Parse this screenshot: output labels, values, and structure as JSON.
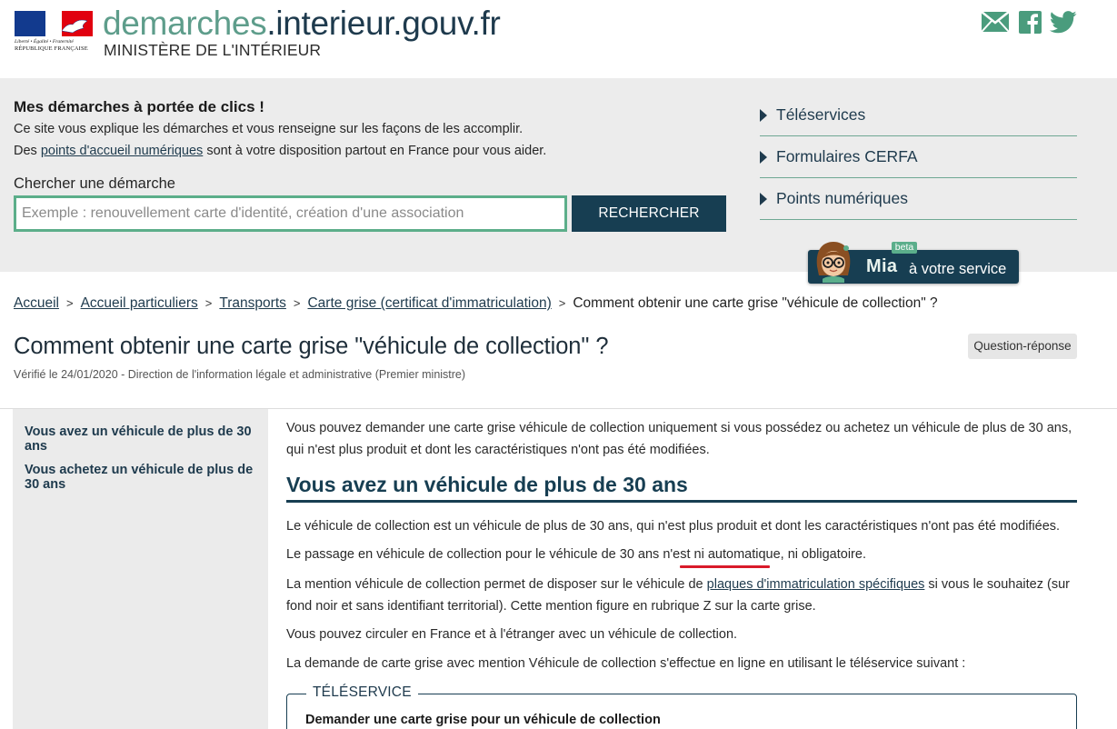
{
  "header": {
    "logo": {
      "motto": "Liberté • Égalité • Fraternité",
      "republic": "RÉPUBLIQUE FRANÇAISE"
    },
    "site_title_main": "demarches",
    "site_title_tail": ".interieur.gouv.fr",
    "site_subtitle": "MINISTÈRE DE L'INTÉRIEUR",
    "social_icons": [
      "mail-icon",
      "facebook-icon",
      "twitter-icon"
    ],
    "brand_color": "#5e9d8b"
  },
  "intro": {
    "title": "Mes démarches à portée de clics !",
    "line1": "Ce site vous explique les démarches et vous renseigne sur les façons de les accomplir.",
    "line2_pre": "Des ",
    "line2_link": "points d'accueil numériques",
    "line2_post": " sont à votre disposition partout en France pour vous aider."
  },
  "search": {
    "label": "Chercher une démarche",
    "placeholder": "Exemple : renouvellement carte d'identité, création d'une association",
    "button": "RECHERCHER"
  },
  "quick_links": [
    "Téléservices",
    "Formulaires CERFA",
    "Points numériques"
  ],
  "mia": {
    "name": "Mia",
    "tagline": "à votre service",
    "badge": "beta"
  },
  "breadcrumb": {
    "items": [
      "Accueil",
      "Accueil particuliers",
      "Transports",
      "Carte grise (certificat d'immatriculation)"
    ],
    "current": "Comment obtenir une carte grise \"véhicule de collection\" ?",
    "separator": ">"
  },
  "page": {
    "title": "Comment obtenir une carte grise \"véhicule de collection\" ?",
    "verified": "Vérifié le 24/01/2020 - Direction de l'information légale et administrative (Premier ministre)",
    "badge": "Question-réponse"
  },
  "toc": [
    "Vous avez un véhicule de plus de 30 ans",
    "Vous achetez un véhicule de plus de 30 ans"
  ],
  "content": {
    "intro": "Vous pouvez demander une carte grise véhicule de collection uniquement si vous possédez ou achetez un véhicule de plus de 30 ans, qui n'est plus produit et dont les caractéristiques n'ont pas été modifiées.",
    "h2": "Vous avez un véhicule de plus de 30 ans",
    "p1": "Le véhicule de collection est un véhicule de plus de 30 ans, qui n'est plus produit et dont les caractéristiques n'ont pas été modifiées.",
    "p2": "Le passage en véhicule de collection pour le véhicule de 30 ans n'est ni automatique, ni obligatoire.",
    "p3_pre": "La mention véhicule de collection permet de disposer sur le véhicule de ",
    "p3_link": "plaques d'immatriculation spécifiques",
    "p3_post": " si vous le souhaitez (sur fond noir et sans identifiant territorial). Cette mention figure en rubrique Z sur la carte grise.",
    "p4": "Vous pouvez circuler en France et à l'étranger avec un véhicule de collection.",
    "p5": "La demande de carte grise avec mention Véhicule de collection s'effectue en ligne en utilisant le téléservice suivant :",
    "teleservice_label": "TÉLÉSERVICE",
    "teleservice_link": "Demander une carte grise pour un véhicule de collection"
  }
}
